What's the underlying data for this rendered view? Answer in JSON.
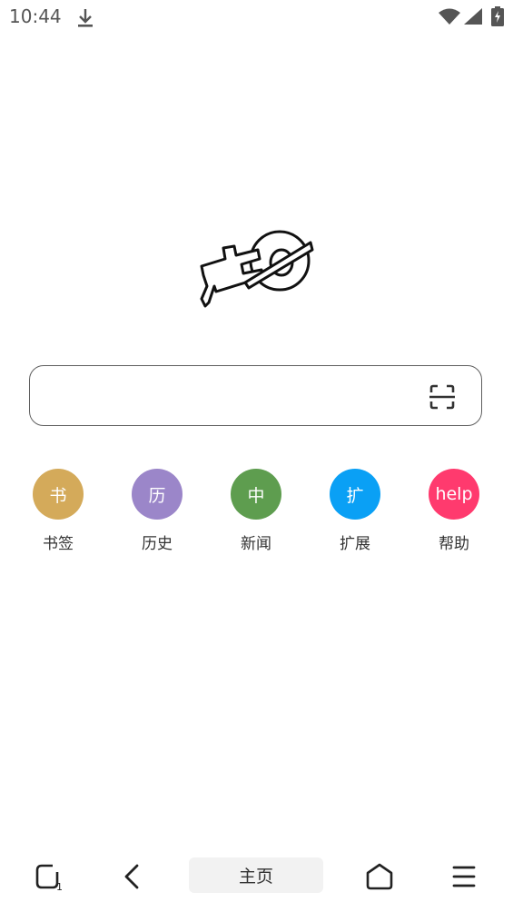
{
  "status_bar": {
    "time": "10:44",
    "icons": [
      "download-icon",
      "wifi-icon",
      "signal-icon",
      "battery-charging-icon"
    ]
  },
  "logo": {
    "icon": "browser-logo"
  },
  "search": {
    "value": "",
    "placeholder": "",
    "scan_icon": "scan-icon"
  },
  "shortcuts": [
    {
      "glyph": "书",
      "label": "书签",
      "color": "#d4aa5a"
    },
    {
      "glyph": "历",
      "label": "历史",
      "color": "#9b86c9"
    },
    {
      "glyph": "中",
      "label": "新闻",
      "color": "#5e9d4f"
    },
    {
      "glyph": "扩",
      "label": "扩展",
      "color": "#0aa0f5"
    },
    {
      "glyph": "help",
      "label": "帮助",
      "color": "#ff3a6e"
    }
  ],
  "bottom_nav": {
    "tabs_count": "1",
    "home_label": "主页",
    "icons": [
      "tabs-icon",
      "back-icon",
      "home-icon",
      "menu-icon"
    ]
  }
}
